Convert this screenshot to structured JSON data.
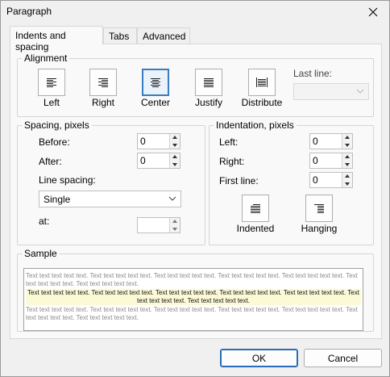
{
  "window": {
    "title": "Paragraph"
  },
  "tabs": [
    {
      "label": "Indents and spacing",
      "active": true
    },
    {
      "label": "Tabs",
      "active": false
    },
    {
      "label": "Advanced",
      "active": false
    }
  ],
  "alignment": {
    "legend": "Alignment",
    "buttons": [
      {
        "label": "Left",
        "icon": "align-left-icon",
        "selected": false
      },
      {
        "label": "Right",
        "icon": "align-right-icon",
        "selected": false
      },
      {
        "label": "Center",
        "icon": "align-center-icon",
        "selected": true
      },
      {
        "label": "Justify",
        "icon": "align-justify-icon",
        "selected": false
      },
      {
        "label": "Distribute",
        "icon": "align-distribute-icon",
        "selected": false
      }
    ],
    "last_line_label": "Last line:",
    "last_line_value": ""
  },
  "spacing": {
    "legend": "Spacing, pixels",
    "before_label": "Before:",
    "before_value": "0",
    "after_label": "After:",
    "after_value": "0",
    "line_spacing_label": "Line spacing:",
    "line_spacing_value": "Single",
    "at_label": "at:",
    "at_value": ""
  },
  "indentation": {
    "legend": "Indentation, pixels",
    "left_label": "Left:",
    "left_value": "0",
    "right_label": "Right:",
    "right_value": "0",
    "first_line_label": "First line:",
    "first_line_value": "0",
    "indented_label": "Indented",
    "hanging_label": "Hanging"
  },
  "sample": {
    "legend": "Sample",
    "before_text": "Text text text text text. Text text text text text. Text text text text text. Text text text text text. Text text text text text. Text text text text text. Text text text text text.",
    "current_text": "Text text text text text. Text text text text text. Text text text text text. Text text text text text. Text text text text text. Text text text text text. Text text text text text.",
    "after_text": "Text text text text text. Text text text text text. Text text text text text. Text text text text text. Text text text text text. Text text text text text. Text text text text text."
  },
  "buttons": {
    "ok": "OK",
    "cancel": "Cancel"
  },
  "colors": {
    "accent": "#2c6bb8",
    "sample_highlight": "#fcfad6"
  }
}
